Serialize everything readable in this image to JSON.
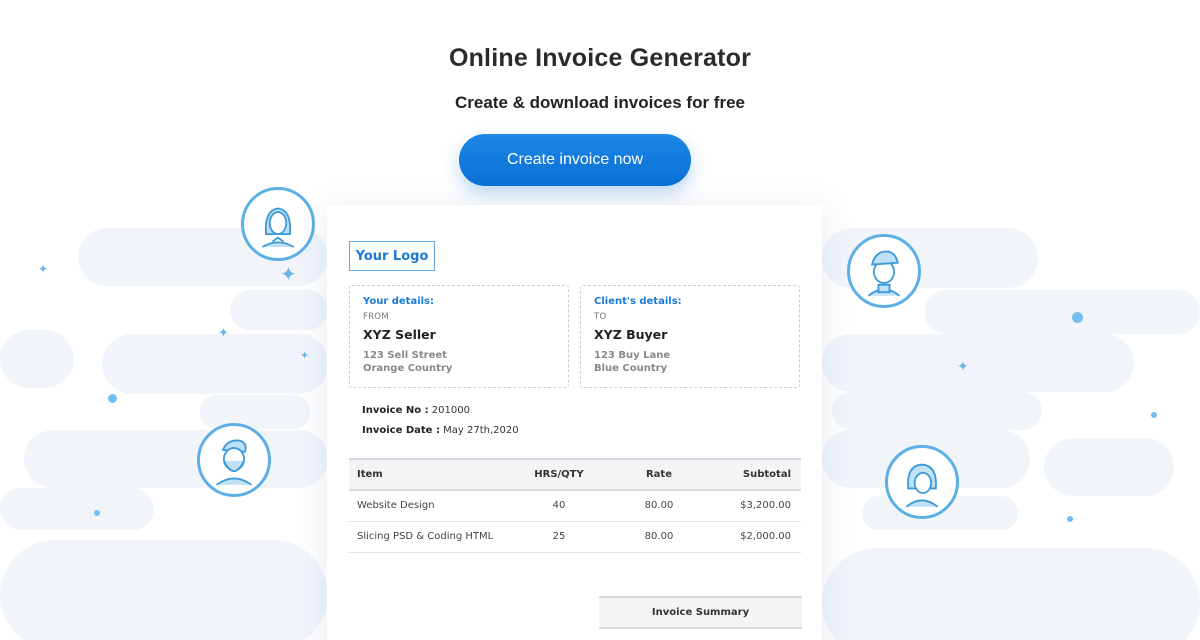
{
  "hero": {
    "title": "Online Invoice Generator",
    "subtitle": "Create & download invoices for free",
    "cta_label": "Create invoice now"
  },
  "invoice": {
    "logo_label": "Your Logo",
    "seller": {
      "heading": "Your details:",
      "direction": "FROM",
      "name": "XYZ Seller",
      "address_line1": "123 Sell Street",
      "address_line2": "Orange Country"
    },
    "client": {
      "heading": "Client's details:",
      "direction": "TO",
      "name": "XYZ Buyer",
      "address_line1": "123 Buy Lane",
      "address_line2": "Blue Country"
    },
    "number_label": "Invoice No :",
    "number_value": "201000",
    "date_label": "Invoice Date :",
    "date_value": "May 27th,2020",
    "columns": [
      "Item",
      "HRS/QTY",
      "Rate",
      "Subtotal"
    ],
    "rows": [
      [
        "Website Design",
        "40",
        "80.00",
        "$3,200.00"
      ],
      [
        "Slicing PSD & Coding HTML",
        "25",
        "80.00",
        "$2,000.00"
      ]
    ],
    "summary_label": "Invoice Summary"
  },
  "colors": {
    "accent": "#1a7bd6",
    "cta_gradient_top": "#1e88e5",
    "cta_gradient_bottom": "#0a6fd6",
    "icon_blue": "#5cb0e6",
    "cloud": "#f1f5fa"
  },
  "icons": [
    "woman-avatar-icon",
    "bearded-man-avatar-icon",
    "man-cap-avatar-icon",
    "woman-bob-avatar-icon",
    "sparkle-icon"
  ]
}
